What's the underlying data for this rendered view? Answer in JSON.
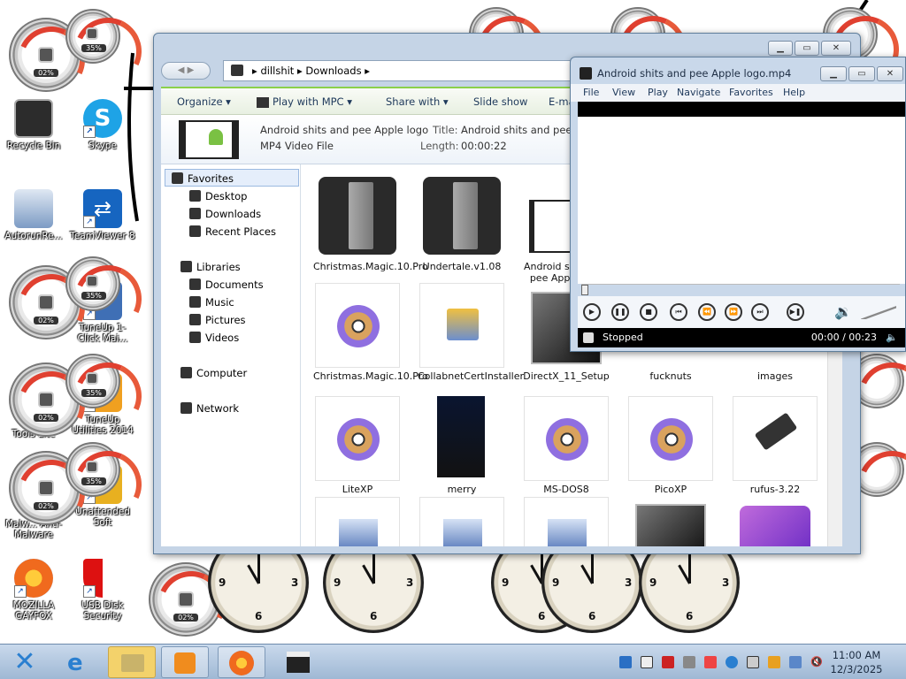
{
  "desktop_icons": [
    {
      "label": "Recycle Bin",
      "icon": "recycle-bin-icon"
    },
    {
      "label": "Skype",
      "icon": "skype-icon"
    },
    {
      "label": "AutorunRe...",
      "icon": "autorun-icon"
    },
    {
      "label": "TeamViewer 8",
      "icon": "teamviewer-icon"
    },
    {
      "label": "TuneUp 1-Click Mai...",
      "icon": "tuneup-icon"
    },
    {
      "label": "Tools Lite",
      "icon": "tools-lite-icon"
    },
    {
      "label": "TuneUp Utilities 2014",
      "icon": "tuneup-utilities-icon"
    },
    {
      "label": "Malw... Anti-Malware",
      "icon": "malwarebytes-icon"
    },
    {
      "label": "Unattended Soft",
      "icon": "unattended-soft-icon"
    },
    {
      "label": "MOZILLA GAYFOX",
      "icon": "firefox-icon"
    },
    {
      "label": "USB Disk Security",
      "icon": "usb-disk-security-icon"
    }
  ],
  "gauges": {
    "pct_a": "02%",
    "pct_b": "35%"
  },
  "explorer": {
    "breadcrumb": [
      "dillshit",
      "Downloads"
    ],
    "toolbar": [
      "Organize",
      "Play with MPC",
      "Share with",
      "Slide show",
      "E-mail"
    ],
    "details": {
      "filename": "Android shits and pee Apple logo",
      "type": "MP4 Video File",
      "title_key": "Title:",
      "title_val": "Android shits and pee Apple logo",
      "length_key": "Length:",
      "length_val": "00:00:22"
    },
    "nav": {
      "favorites": "Favorites",
      "desktop": "Desktop",
      "downloads": "Downloads",
      "recent": "Recent Places",
      "libraries": "Libraries",
      "documents": "Documents",
      "music": "Music",
      "pictures": "Pictures",
      "videos": "Videos",
      "computer": "Computer",
      "network": "Network"
    },
    "files": [
      "Christmas.Magic.10.Pro",
      "Undertale.v1.08",
      "Android shits and pee Apple logo",
      "Christmas.Magic.10.Pro",
      "CollabnetCertInstaller",
      "DirectX_11_Setup",
      "fucknuts",
      "images",
      "LiteXP",
      "merry",
      "MS-DOS8",
      "PicoXP",
      "rufus-3.22"
    ]
  },
  "mpc": {
    "title": "Android shits and pee Apple logo.mp4",
    "menu": [
      "File",
      "View",
      "Play",
      "Navigate",
      "Favorites",
      "Help"
    ],
    "status": "Stopped",
    "time": "00:00 / 00:23"
  },
  "taskbar": {
    "time": "11:00 AM",
    "date": "12/3/2025"
  }
}
